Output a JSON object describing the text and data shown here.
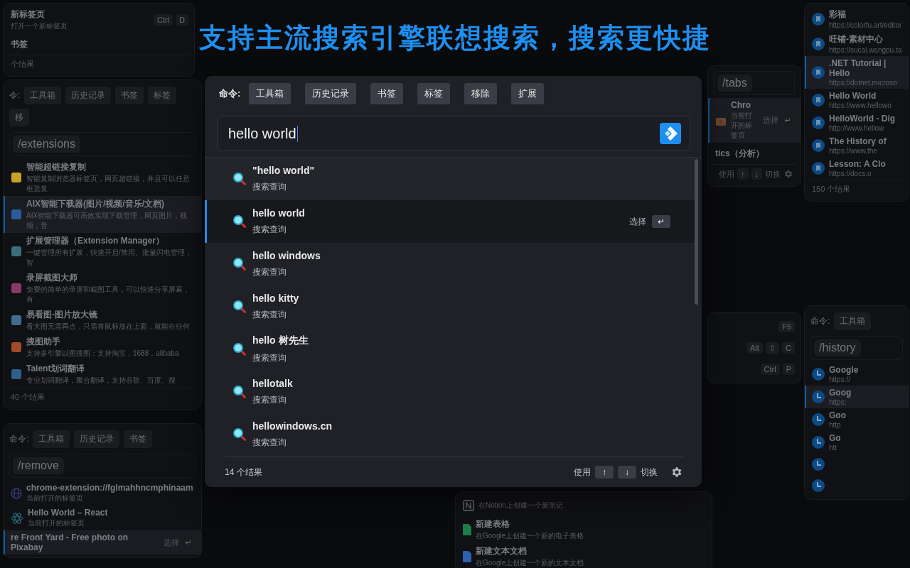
{
  "headline": "支持主流搜索引擎联想搜索，搜索更快捷",
  "main": {
    "commands_label": "命令:",
    "commands": [
      "工具箱",
      "历史记录",
      "书签",
      "标签",
      "移除",
      "扩展"
    ],
    "query": "hello world",
    "select_label": "选择",
    "select_key": "↵",
    "results": [
      {
        "title": "\"hello world\"",
        "subtitle": "搜索查询",
        "selected": false
      },
      {
        "title": "hello world",
        "subtitle": "搜索查询",
        "selected": true
      },
      {
        "title": "hello windows",
        "subtitle": "搜索查询",
        "selected": false
      },
      {
        "title": "hello kitty",
        "subtitle": "搜索查询",
        "selected": false
      },
      {
        "title": "hello 树先生",
        "subtitle": "搜索查询",
        "selected": false
      },
      {
        "title": "hellotalk",
        "subtitle": "搜索查询",
        "selected": false
      },
      {
        "title": "hellowindows.cn",
        "subtitle": "搜索查询",
        "selected": false
      }
    ],
    "footer": {
      "count": "14 个结果",
      "use": "使用",
      "up": "↑",
      "down": "↓",
      "switch": "切换"
    }
  },
  "panels": [
    {
      "items": [
        {
          "kind": "plain",
          "title": "新标签页",
          "subtitle": "打开一个新标签页",
          "keys": [
            "Ctrl",
            "D"
          ]
        },
        {
          "kind": "plain",
          "title": "书签"
        }
      ],
      "footer": {
        "count": "个结果"
      }
    },
    {
      "commands": {
        "label": "令:",
        "items": [
          "工具箱",
          "历史记录",
          "书签",
          "标签",
          "移"
        ]
      },
      "query": "/extensions",
      "items": [
        {
          "kind": "app",
          "color": "#c9a227",
          "title": "智能超链接复制",
          "subtitle": "智能复制浏览器标签页，网页超链接，并且可以任意框选复",
          "selected": false
        },
        {
          "kind": "app",
          "color": "#2a5d9c",
          "title": "AIX智能下载器(图片/视频/音乐/文档)",
          "subtitle": "AIX智能下载器可高效实现下载管理，网页图片，视频，音",
          "selected": true
        },
        {
          "kind": "app",
          "color": "#3a6f7a",
          "title": "扩展管理器（Extension Manager）",
          "subtitle": "一键管理所有扩展，快速开启/禁用、批量闪电管理，智",
          "selected": false
        },
        {
          "kind": "app",
          "color": "#8a3a6a",
          "title": "录屏截图大师",
          "subtitle": "免费的简单的录屏和截图工具，可以快速分享屏幕，有",
          "selected": false
        },
        {
          "kind": "app",
          "color": "#3f6e8c",
          "title": "易看图-图片放大镜",
          "subtitle": "看大图无需再点，只需将鼠标放在上面，就能在任何",
          "selected": false
        },
        {
          "kind": "app",
          "color": "#a24a2a",
          "title": "搜图助手",
          "subtitle": "支持多引擎以图搜图；支持淘宝，1688，alibaba",
          "selected": false
        },
        {
          "kind": "app",
          "color": "#2d5f8a",
          "title": "Talent划词翻译",
          "subtitle": "专业划词翻译，聚合翻译，支持谷歌、百度、搜",
          "selected": false
        }
      ],
      "footer": {
        "count": "40 个结果"
      }
    },
    {
      "commands": {
        "label": "命令:",
        "items": [
          "工具箱",
          "历史记录",
          "书签"
        ]
      },
      "query": "/remove",
      "items": [
        {
          "kind": "globe",
          "title": "chrome-extension://fglmahhncmphinaam",
          "subtitle": "当前打开的标签页",
          "selected": false
        },
        {
          "kind": "atom",
          "title": "Hello World – React",
          "subtitle": "当前打开的标签页",
          "selected": false
        },
        {
          "kind": "plain",
          "title": "re Front Yard - Free photo on Pixabay",
          "hint": "选择",
          "keys": [
            "↵"
          ],
          "selected": true
        }
      ]
    },
    {
      "query": "/tabs",
      "items": [
        {
          "kind": "store",
          "title": "Chro",
          "subtitle": "当前打开的标签页",
          "hint": "选择",
          "keys": [
            "↵"
          ],
          "selected": true
        },
        {
          "kind": "plain",
          "title": "tics（分析）",
          "selected": false
        }
      ],
      "footer": {
        "use": "使用",
        "up": "↑",
        "down": "↓",
        "switch": "切换"
      }
    },
    {
      "items": [
        {
          "kind": "plain",
          "keys": [
            "F5"
          ]
        },
        {
          "kind": "plain",
          "keys": [
            "Alt",
            "⇧",
            "C"
          ]
        },
        {
          "kind": "plain",
          "keys": [
            "Ctrl",
            "P"
          ]
        }
      ]
    },
    {
      "items": [
        {
          "kind": "notion",
          "subtitle": "在Notion上创建一个新笔记"
        },
        {
          "kind": "doc",
          "color": "#1e7d45",
          "title": "新建表格",
          "subtitle": "在Google上创建一个新的电子表格"
        },
        {
          "kind": "doc",
          "color": "#2f5fb3",
          "title": "新建文本文档",
          "subtitle": "在Google上创建一个新的文本文档"
        }
      ]
    },
    {
      "items": [
        {
          "kind": "bookmark",
          "title": "彩福",
          "subtitle": "https://colorfu.art/editor",
          "selected": false
        },
        {
          "kind": "bookmark",
          "title": "旺铺-素材中心",
          "subtitle": "https://sucai.wangpu.ta",
          "selected": false
        },
        {
          "kind": "bookmark",
          "title": ".NET Tutorial | Hello",
          "subtitle": "https://dotnet.microso",
          "selected": true
        },
        {
          "kind": "bookmark",
          "title": "Hello World",
          "subtitle": "https://www.hellowo",
          "selected": false
        },
        {
          "kind": "bookmark",
          "title": "HelloWorld - Dig",
          "subtitle": "http://www.hellow",
          "selected": false
        },
        {
          "kind": "bookmark",
          "title": "The History of",
          "subtitle": "https://www.the",
          "selected": false
        },
        {
          "kind": "bookmark",
          "title": "Lesson: A Clo",
          "subtitle": "https://docs.o",
          "selected": false
        }
      ],
      "footer": {
        "count": "150 个结果"
      }
    },
    {
      "commands": {
        "label": "命令:",
        "items": [
          "工具箱"
        ]
      },
      "query": "/history",
      "items": [
        {
          "kind": "history",
          "title": "Google",
          "subtitle": "https://",
          "selected": false
        },
        {
          "kind": "history",
          "title": "Goog",
          "subtitle": "https:",
          "selected": true
        },
        {
          "kind": "history",
          "title": "Goo",
          "subtitle": "http",
          "selected": false
        },
        {
          "kind": "history",
          "title": "Go",
          "subtitle": "htt",
          "selected": false
        },
        {
          "kind": "history",
          "selected": false
        },
        {
          "kind": "history",
          "selected": false
        }
      ]
    }
  ]
}
